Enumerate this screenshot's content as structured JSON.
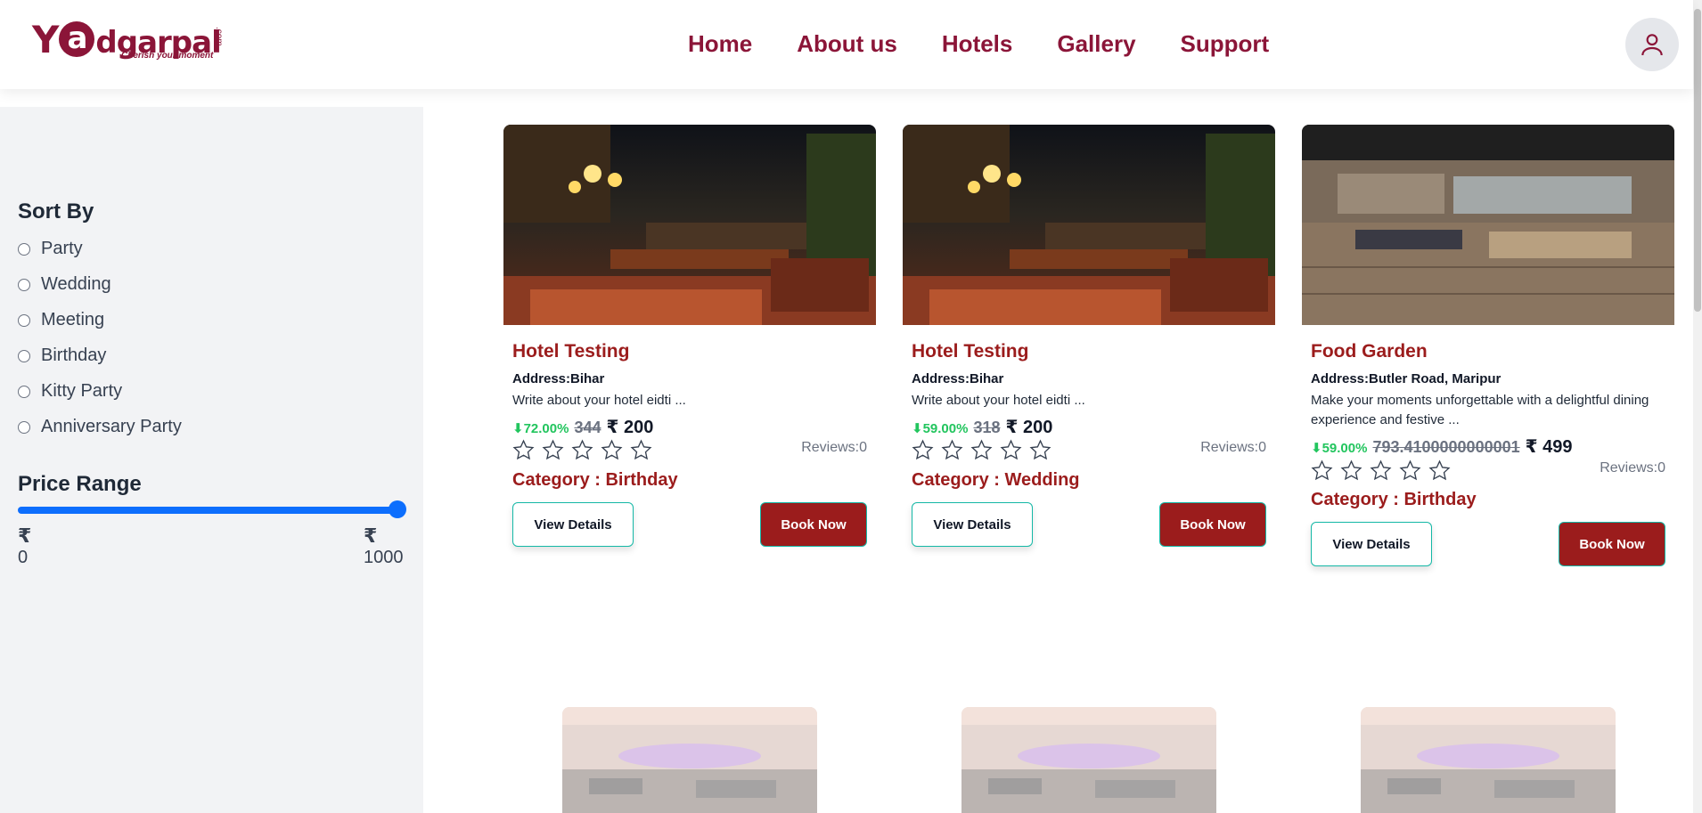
{
  "brand": {
    "logo_text": "Yaadgarpal",
    "logo_letter": "a",
    "logo_prefix": "Y",
    "logo_suffix": "dgarpal",
    "logo_dotcom": ".com",
    "tagline": "Cherish your moment"
  },
  "nav": {
    "items": [
      "Home",
      "About us",
      "Hotels",
      "Gallery",
      "Support"
    ]
  },
  "sidebar": {
    "sort_title": "Sort By",
    "sort_options": [
      "Party",
      "Wedding",
      "Meeting",
      "Birthday",
      "Kitty Party",
      "Anniversary Party"
    ],
    "price_title": "Price Range",
    "currency": "₹",
    "price_min": "0",
    "price_max": "1000",
    "slider_value_fraction": 1.0
  },
  "cards": [
    {
      "title": "Hotel Testing",
      "address": "Address:Bihar",
      "desc": "Write about your hotel eidti ...",
      "discount": "⬇72.00%",
      "old_price": "344",
      "new_price": "₹ 200",
      "rating": 0,
      "reviews": "Reviews:0",
      "category": "Category : Birthday",
      "view_label": "View Details",
      "book_label": "Book Now"
    },
    {
      "title": "Hotel Testing",
      "address": "Address:Bihar",
      "desc": "Write about your hotel eidti ...",
      "discount": "⬇59.00%",
      "old_price": "318",
      "new_price": "₹ 200",
      "rating": 0,
      "reviews": "Reviews:0",
      "category": "Category : Wedding",
      "view_label": "View Details",
      "book_label": "Book Now"
    },
    {
      "title": "Food Garden",
      "address": "Address:Butler Road, Maripur",
      "desc": "Make your moments unforgettable with a delightful dining experience and festive ...",
      "discount": "⬇59.00%",
      "old_price": "793.4100000000001",
      "new_price": "₹ 499",
      "rating": 0,
      "reviews": "Reviews:0",
      "category": "Category : Birthday",
      "view_label": "View Details",
      "book_label": "Book Now"
    }
  ],
  "colors": {
    "brand": "#8b1538",
    "accent_red": "#9b1c1c",
    "discount_green": "#22c55e",
    "slider_blue": "#0d6efd",
    "button_border": "#14b8a6"
  }
}
